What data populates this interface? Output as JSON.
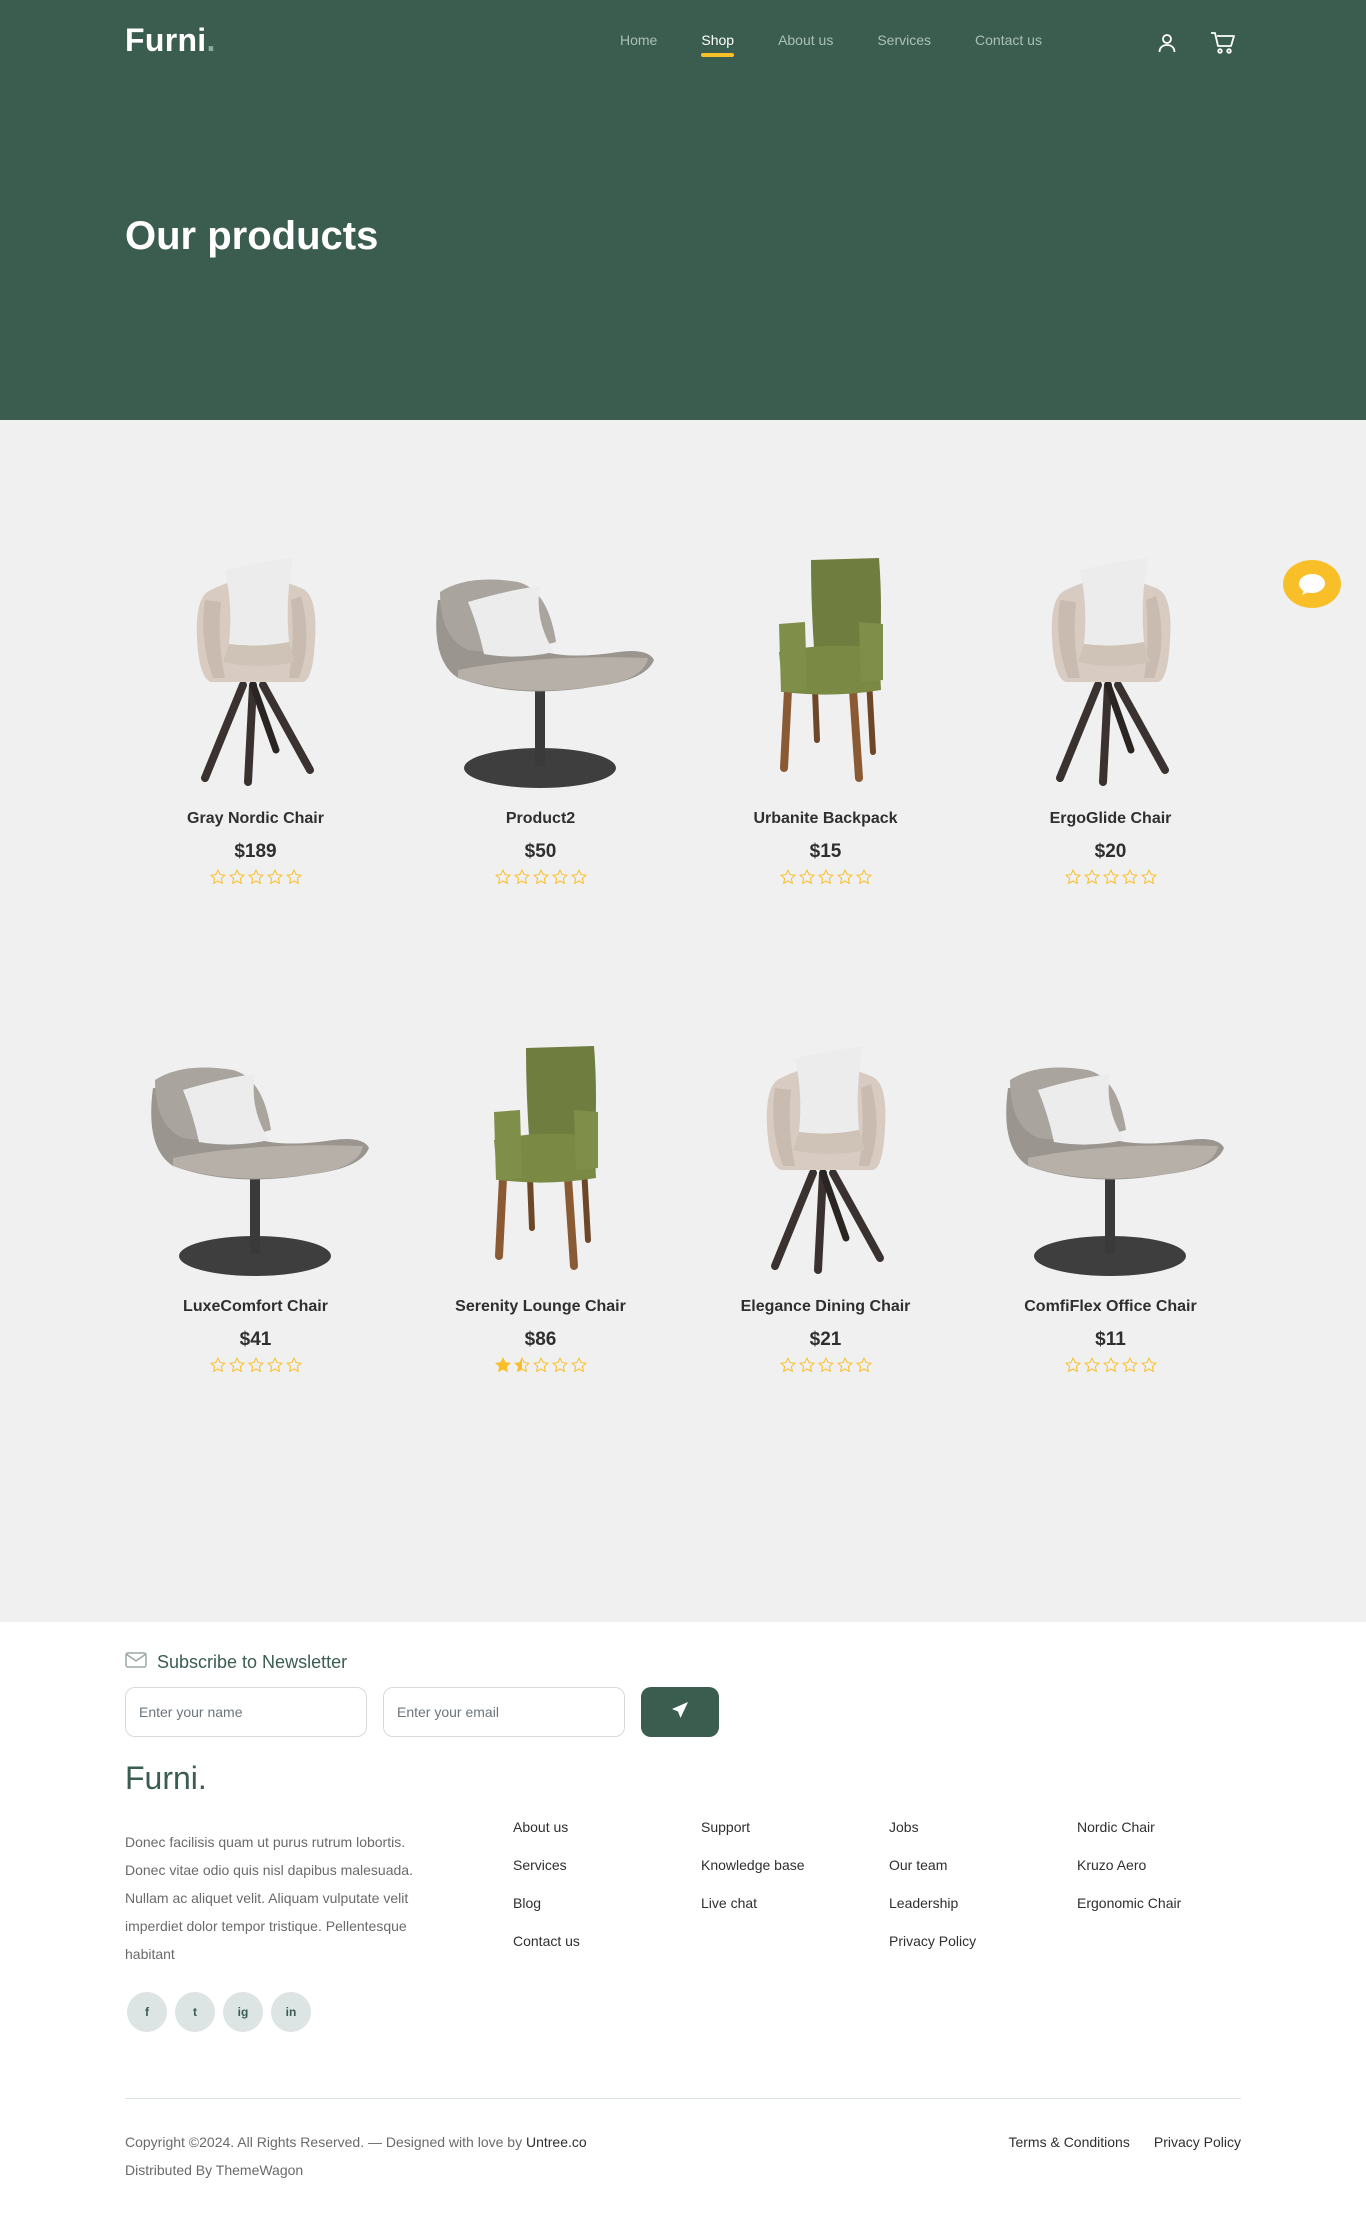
{
  "brand": {
    "logo_text": "Furni",
    "logo_dot": "."
  },
  "nav": {
    "items": [
      {
        "label": "Home",
        "active": false
      },
      {
        "label": "Shop",
        "active": true
      },
      {
        "label": "About us",
        "active": false
      },
      {
        "label": "Services",
        "active": false
      },
      {
        "label": "Contact us",
        "active": false
      }
    ],
    "icons": [
      "user-icon",
      "cart-icon"
    ]
  },
  "hero": {
    "title": "Our products"
  },
  "products": [
    {
      "name": "Gray Nordic Chair",
      "price": "$189",
      "rating": 0,
      "image": "armchair-beige"
    },
    {
      "name": "Product2",
      "price": "$50",
      "rating": 0,
      "image": "lounge-chair-gray"
    },
    {
      "name": "Urbanite Backpack",
      "price": "$15",
      "rating": 0,
      "image": "dining-chair-green"
    },
    {
      "name": "ErgoGlide Chair",
      "price": "$20",
      "rating": 0,
      "image": "armchair-beige"
    },
    {
      "name": "LuxeComfort Chair",
      "price": "$41",
      "rating": 0,
      "image": "lounge-chair-gray"
    },
    {
      "name": "Serenity Lounge Chair",
      "price": "$86",
      "rating": 1.5,
      "image": "dining-chair-green"
    },
    {
      "name": "Elegance Dining Chair",
      "price": "$21",
      "rating": 0,
      "image": "armchair-beige"
    },
    {
      "name": "ComfiFlex Office Chair",
      "price": "$11",
      "rating": 0,
      "image": "lounge-chair-gray"
    }
  ],
  "colors": {
    "primary": "#3b5d50",
    "accent": "#f9bf29",
    "background": "#eff0ef"
  },
  "newsletter": {
    "title": "Subscribe to Newsletter",
    "name_placeholder": "Enter your name",
    "email_placeholder": "Enter your email",
    "icon": "envelope-icon",
    "send_icon": "paper-plane-icon"
  },
  "footer": {
    "logo_text": "Furni.",
    "description": "Donec facilisis quam ut purus rutrum lobortis. Donec vitae odio quis nisl dapibus malesuada. Nullam ac aliquet velit. Aliquam vulputate velit imperdiet dolor tempor tristique. Pellentesque habitant",
    "socials": [
      {
        "label": "f",
        "icon": "facebook-icon"
      },
      {
        "label": "t",
        "icon": "twitter-icon"
      },
      {
        "label": "ig",
        "icon": "instagram-icon"
      },
      {
        "label": "in",
        "icon": "linkedin-icon"
      }
    ],
    "columns": [
      [
        "About us",
        "Services",
        "Blog",
        "Contact us"
      ],
      [
        "Support",
        "Knowledge base",
        "Live chat"
      ],
      [
        "Jobs",
        "Our team",
        "Leadership",
        "Privacy Policy"
      ],
      [
        "Nordic Chair",
        "Kruzo Aero",
        "Ergonomic Chair"
      ]
    ],
    "copyright_text": "Copyright ©2024. All Rights Reserved. — Designed with love by ",
    "copyright_link": "Untree.co",
    "distributed": "Distributed By ThemeWagon",
    "legal": [
      "Terms & Conditions",
      "Privacy Policy"
    ]
  },
  "chat": {
    "icon": "chat-icon"
  }
}
